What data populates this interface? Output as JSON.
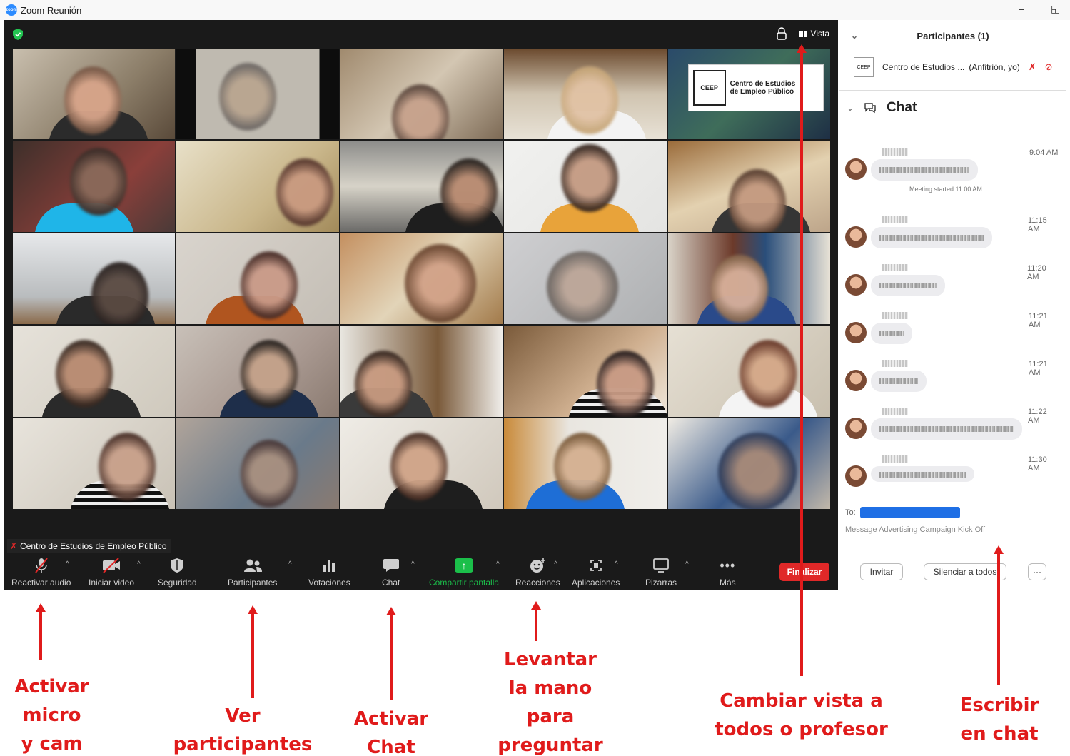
{
  "window": {
    "title": "Zoom Reunión",
    "minimize": "–",
    "restore": "◱"
  },
  "meeting": {
    "top_right": {
      "vista_label": "Vista"
    },
    "logo": {
      "mark": "CEEP",
      "text_line1": "Centro de Estudios",
      "text_line2": "de Empleo Público"
    },
    "name_tag": "Centro de Estudios de Empleo Público",
    "toolbar": {
      "reactivar_audio": "Reactivar audio",
      "iniciar_video": "Iniciar video",
      "seguridad": "Seguridad",
      "participantes": "Participantes",
      "votaciones": "Votaciones",
      "chat": "Chat",
      "compartir_pantalla": "Compartir pantalla",
      "reacciones": "Reacciones",
      "aplicaciones": "Aplicaciones",
      "pizarras": "Pizarras",
      "mas": "Más",
      "finalizar": "Finalizar"
    },
    "colors": {
      "share_green": "#1bbf4a",
      "end_red": "#e02828"
    }
  },
  "panel": {
    "participants_header": "Participantes (1)",
    "host_name": "Centro de Estudios ...",
    "host_role": "(Anfitrión, yo)",
    "chat_title": "Chat",
    "system_message": "Meeting started 11:00 AM",
    "messages": [
      {
        "time": "9:04 AM"
      },
      {
        "time": "11:15 AM"
      },
      {
        "time": "11:20 AM"
      },
      {
        "time": "11:21 AM"
      },
      {
        "time": "11:21 AM"
      },
      {
        "time": "11:22 AM"
      },
      {
        "time": "11:30 AM"
      }
    ],
    "to_label": "To:",
    "input_placeholder": "Message Advertising Campaign Kick Off",
    "buttons": {
      "invitar": "Invitar",
      "silenciar": "Silenciar a todos",
      "more": "···"
    }
  },
  "annotations": {
    "micro": "Activar\nmicro\ny cam",
    "participantes": "Ver\nparticipantes",
    "chat": "Activar\nChat",
    "mano": "Levantar\nla mano\npara\npreguntar",
    "vista": "Cambiar vista a\ntodos o profesor",
    "escribir": "Escribir\nen chat",
    "color": "#e01b1b"
  }
}
